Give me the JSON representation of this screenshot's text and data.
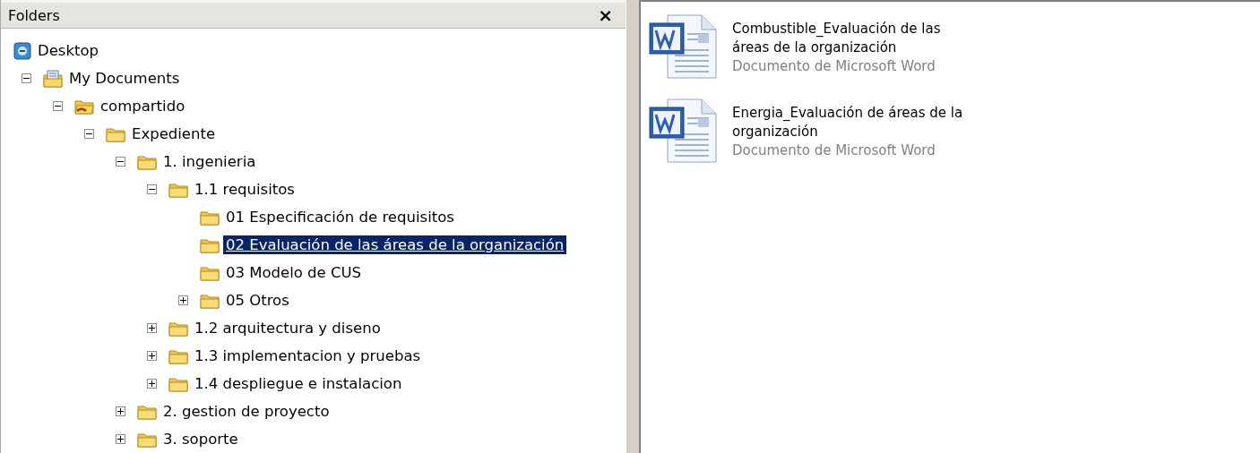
{
  "folders_pane": {
    "title": "Folders",
    "close": "×",
    "tree": [
      {
        "label": "Desktop",
        "kind": "desktop",
        "selected": false,
        "children": [
          {
            "label": "My Documents",
            "kind": "documents",
            "selected": false,
            "expanded": true,
            "children": [
              {
                "label": "compartido",
                "kind": "shared",
                "selected": false,
                "expanded": true,
                "children": [
                  {
                    "label": "Expediente",
                    "kind": "folder",
                    "selected": false,
                    "expanded": true,
                    "children": [
                      {
                        "label": "1. ingenieria",
                        "kind": "folder",
                        "selected": false,
                        "expanded": true,
                        "children": [
                          {
                            "label": "1.1 requisitos",
                            "kind": "folder",
                            "selected": false,
                            "expanded": true,
                            "children": [
                              {
                                "label": "01 Especificación de requisitos",
                                "kind": "folder",
                                "selected": false
                              },
                              {
                                "label": "02 Evaluación de las áreas de la organización",
                                "kind": "folder",
                                "selected": true
                              },
                              {
                                "label": "03 Modelo de CUS",
                                "kind": "folder",
                                "selected": false
                              },
                              {
                                "label": "05 Otros",
                                "kind": "folder",
                                "selected": false,
                                "expanded": false
                              }
                            ]
                          },
                          {
                            "label": "1.2 arquitectura y diseno",
                            "kind": "folder",
                            "selected": false,
                            "expanded": false
                          },
                          {
                            "label": "1.3 implementacion y pruebas",
                            "kind": "folder",
                            "selected": false,
                            "expanded": false
                          },
                          {
                            "label": "1.4 despliegue e instalacion",
                            "kind": "folder",
                            "selected": false,
                            "expanded": false
                          }
                        ]
                      },
                      {
                        "label": "2. gestion de proyecto",
                        "kind": "folder",
                        "selected": false,
                        "expanded": false
                      },
                      {
                        "label": "3. soporte",
                        "kind": "folder",
                        "selected": false,
                        "expanded": false
                      }
                    ]
                  }
                ]
              }
            ]
          }
        ]
      }
    ]
  },
  "files": [
    {
      "name": "Combustible_Evaluación de las áreas de la organización",
      "type": "Documento de Microsoft Word",
      "selected": false
    },
    {
      "name": "Energia_Evaluación de áreas de la organización",
      "type": "Documento de Microsoft Word",
      "selected": false
    }
  ]
}
